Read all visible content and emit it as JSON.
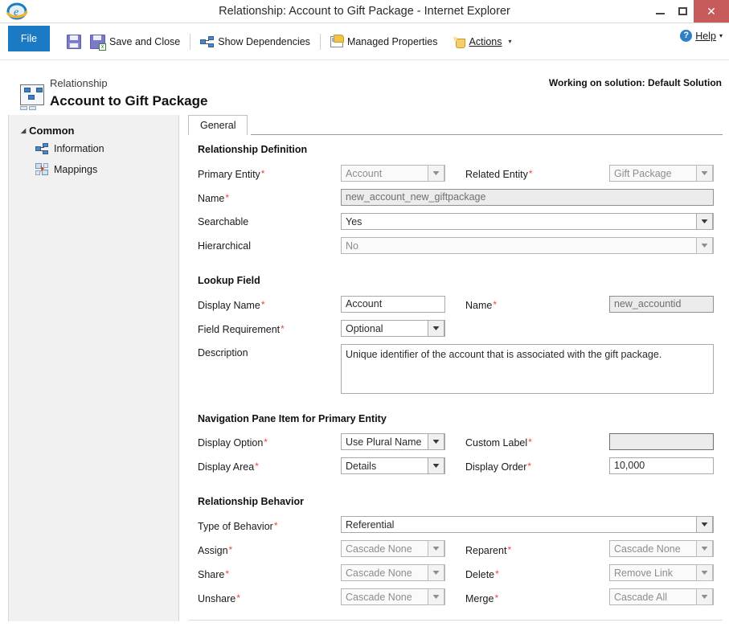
{
  "window": {
    "title": "Relationship: Account to Gift Package - Internet Explorer",
    "app_icon": "internet-explorer-icon",
    "minimize_label": "",
    "maximize_label": "",
    "close_label": "✕"
  },
  "ribbon": {
    "file_label": "File",
    "commands": [
      {
        "label": "Save",
        "icon": "save-icon",
        "text_hidden": true
      },
      {
        "label": "Save and Close",
        "icon": "save-and-close-icon"
      },
      {
        "label": "Show Dependencies",
        "icon": "dependencies-icon"
      },
      {
        "label": "Managed Properties",
        "icon": "managed-properties-icon"
      },
      {
        "label": "Actions",
        "icon": "actions-icon",
        "caret": "▾"
      }
    ],
    "help_label": "Help",
    "help_caret": "▾",
    "help_icon": "help-icon"
  },
  "header": {
    "kicker": "Relationship",
    "title": "Account to Gift Package",
    "solution": "Working on solution: Default Solution",
    "entity_icon": "relationship-icon"
  },
  "sidebar": {
    "group_label": "Common",
    "group_caret": "◢",
    "items": [
      {
        "label": "Information",
        "icon": "information-icon"
      },
      {
        "label": "Mappings",
        "icon": "mappings-icon"
      }
    ]
  },
  "tabs": [
    {
      "label": "General",
      "selected": true
    }
  ],
  "sections": {
    "relationship_definition": {
      "title": "Relationship Definition",
      "primary_entity": {
        "label": "Primary Entity",
        "required": "*",
        "value": "Account",
        "disabled": true
      },
      "related_entity": {
        "label": "Related Entity",
        "required": "*",
        "value": "Gift Package",
        "disabled": true
      },
      "name": {
        "label": "Name",
        "required": "*",
        "value": "new_account_new_giftpackage",
        "readonly": true
      },
      "searchable": {
        "label": "Searchable",
        "required": "",
        "value": "Yes",
        "disabled": false
      },
      "hierarchical": {
        "label": "Hierarchical",
        "required": "",
        "value": "No",
        "disabled": true
      }
    },
    "lookup_field": {
      "title": "Lookup Field",
      "display_name": {
        "label": "Display Name",
        "required": "*",
        "value": "Account"
      },
      "name": {
        "label": "Name",
        "required": "*",
        "value": "new_accountid",
        "readonly": true
      },
      "field_requirement": {
        "label": "Field Requirement",
        "required": "*",
        "value": "Optional"
      },
      "description": {
        "label": "Description",
        "value": "Unique identifier of the account that is associated with the gift package."
      }
    },
    "navigation_pane": {
      "title": "Navigation Pane Item for Primary Entity",
      "display_option": {
        "label": "Display Option",
        "required": "*",
        "value": "Use Plural Name"
      },
      "custom_label": {
        "label": "Custom Label",
        "required": "*",
        "value": "",
        "disabled": true
      },
      "display_area": {
        "label": "Display Area",
        "required": "*",
        "value": "Details"
      },
      "display_order": {
        "label": "Display Order",
        "required": "*",
        "value": "10,000"
      }
    },
    "relationship_behavior": {
      "title": "Relationship Behavior",
      "type_of_behavior": {
        "label": "Type of Behavior",
        "required": "*",
        "value": "Referential"
      },
      "assign": {
        "label": "Assign",
        "required": "*",
        "value": "Cascade None",
        "disabled": true
      },
      "reparent": {
        "label": "Reparent",
        "required": "*",
        "value": "Cascade None",
        "disabled": true
      },
      "share": {
        "label": "Share",
        "required": "*",
        "value": "Cascade None",
        "disabled": true
      },
      "delete": {
        "label": "Delete",
        "required": "*",
        "value": "Remove Link",
        "disabled": true
      },
      "unshare": {
        "label": "Unshare",
        "required": "*",
        "value": "Cascade None",
        "disabled": true
      },
      "merge": {
        "label": "Merge",
        "required": "*",
        "value": "Cascade All",
        "disabled": true
      }
    }
  },
  "colors": {
    "file_tab": "#1b7ac4",
    "close_button": "#c75b5b",
    "required_marker": "#e8463c",
    "sidebar_bg": "#f1f1f1"
  }
}
